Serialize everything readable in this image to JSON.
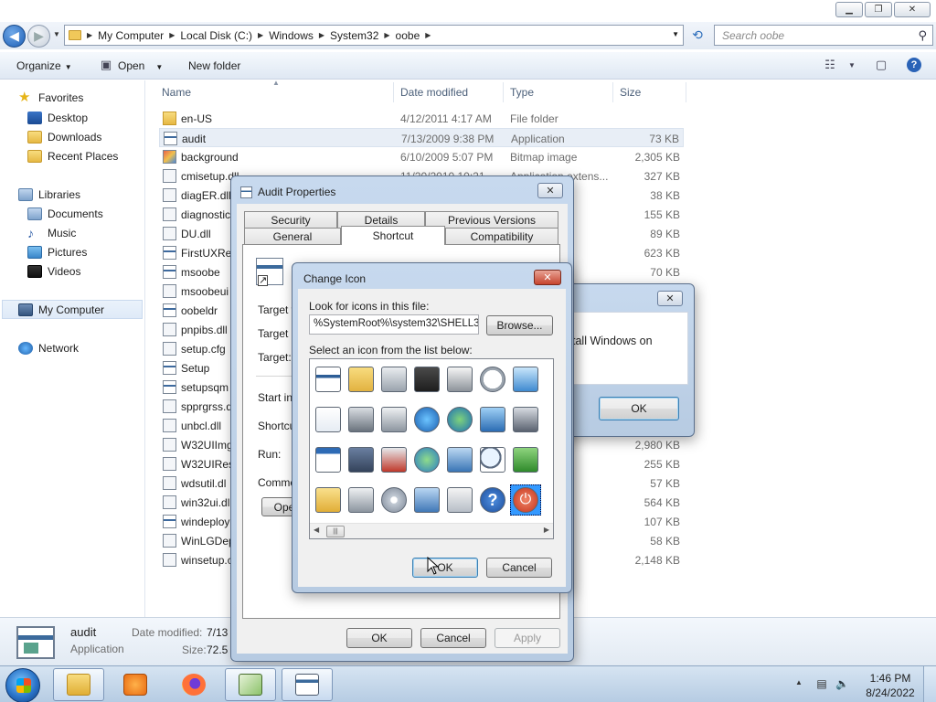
{
  "explorer": {
    "breadcrumb": [
      "My Computer",
      "Local Disk (C:)",
      "Windows",
      "System32",
      "oobe"
    ],
    "search_placeholder": "Search oobe",
    "toolbar": {
      "organize": "Organize",
      "open": "Open",
      "new_folder": "New folder"
    },
    "nav": {
      "favorites": "Favorites",
      "desktop": "Desktop",
      "downloads": "Downloads",
      "recent": "Recent Places",
      "libraries": "Libraries",
      "documents": "Documents",
      "music": "Music",
      "pictures": "Pictures",
      "videos": "Videos",
      "computer": "My Computer",
      "network": "Network"
    },
    "columns": {
      "name": "Name",
      "date": "Date modified",
      "type": "Type",
      "size": "Size"
    },
    "files": [
      {
        "name": "en-US",
        "date": "4/12/2011 4:17 AM",
        "type": "File folder",
        "size": "",
        "icon": "folder"
      },
      {
        "name": "audit",
        "date": "7/13/2009 9:38 PM",
        "type": "Application",
        "size": "73 KB",
        "icon": "app"
      },
      {
        "name": "background",
        "date": "6/10/2009 5:07 PM",
        "type": "Bitmap image",
        "size": "2,305 KB",
        "icon": "bmp"
      },
      {
        "name": "cmisetup.dll",
        "date": "11/20/2010 10:21...",
        "type": "Application extens...",
        "size": "327 KB",
        "icon": "dll"
      },
      {
        "name": "diagER.dll",
        "date": "",
        "type": "xtens...",
        "size": "38 KB",
        "icon": "dll"
      },
      {
        "name": "diagnostic",
        "date": "",
        "type": "xtens...",
        "size": "155 KB",
        "icon": "dll"
      },
      {
        "name": "DU.dll",
        "date": "",
        "type": "xtens...",
        "size": "89 KB",
        "icon": "dll"
      },
      {
        "name": "FirstUXRes",
        "date": "",
        "type": "",
        "size": "623 KB",
        "icon": "app"
      },
      {
        "name": "msoobe",
        "date": "",
        "type": "",
        "size": "70 KB",
        "icon": "app"
      },
      {
        "name": "msoobeui",
        "date": "",
        "type": "",
        "size": "",
        "icon": "dll"
      },
      {
        "name": "oobeldr",
        "date": "",
        "type": "",
        "size": "",
        "icon": "app"
      },
      {
        "name": "pnpibs.dll",
        "date": "",
        "type": "",
        "size": "",
        "icon": "dll"
      },
      {
        "name": "setup.cfg",
        "date": "",
        "type": "",
        "size": "",
        "icon": "cfg"
      },
      {
        "name": "Setup",
        "date": "",
        "type": "",
        "size": "",
        "icon": "setup"
      },
      {
        "name": "setupsqm",
        "date": "",
        "type": "",
        "size": "",
        "icon": "app"
      },
      {
        "name": "spprgrss.d",
        "date": "",
        "type": "",
        "size": "",
        "icon": "dll"
      },
      {
        "name": "unbcl.dll",
        "date": "",
        "type": "",
        "size": "",
        "icon": "dll"
      },
      {
        "name": "W32UIImg",
        "date": "",
        "type": "xtens...",
        "size": "2,980 KB",
        "icon": "dll"
      },
      {
        "name": "W32UIRes",
        "date": "",
        "type": "xtens...",
        "size": "255 KB",
        "icon": "dll"
      },
      {
        "name": "wdsutil.dl",
        "date": "",
        "type": "xtens...",
        "size": "57 KB",
        "icon": "dll"
      },
      {
        "name": "win32ui.dl",
        "date": "",
        "type": "xtens...",
        "size": "564 KB",
        "icon": "dll"
      },
      {
        "name": "windeploy",
        "date": "",
        "type": "",
        "size": "107 KB",
        "icon": "app"
      },
      {
        "name": "WinLGDep",
        "date": "",
        "type": "xtens...",
        "size": "58 KB",
        "icon": "dll"
      },
      {
        "name": "winsetup.c",
        "date": "",
        "type": "xtens...",
        "size": "2,148 KB",
        "icon": "dll"
      }
    ],
    "details": {
      "name": "audit",
      "type": "Application",
      "date_label": "Date modified:",
      "date_value": "7/13",
      "size_label": "Size:",
      "size_value": "72.5"
    }
  },
  "audit_dialog": {
    "title": "Audit Properties",
    "tabs_row1": [
      "Security",
      "Details",
      "Previous Versions"
    ],
    "tabs_row2": [
      "General",
      "Shortcut",
      "Compatibility"
    ],
    "active_tab": "Shortcut",
    "labels": {
      "target_type": "Target ty",
      "target_location": "Target lo",
      "target": "Target:",
      "start_in": "Start in:",
      "shortcut_key": "Shortcut",
      "run": "Run:",
      "comment": "Commen"
    },
    "open_btn": "Ope",
    "ok": "OK",
    "cancel": "Cancel",
    "apply": "Apply"
  },
  "msg_dialog": {
    "text": "tall Windows on",
    "ok": "OK"
  },
  "change_icon": {
    "title": "Change Icon",
    "look_label": "Look for icons in this file:",
    "path": "%SystemRoot%\\system32\\SHELL32.dll",
    "browse": "Browse...",
    "select_label": "Select an icon from the list below:",
    "ok": "OK",
    "cancel": "Cancel",
    "icons": [
      "application-window-icon",
      "folder-icon",
      "drive-icon",
      "chip-icon",
      "printer-icon",
      "clock-icon",
      "monitor-icon",
      "document-icon",
      "network-drive-icon",
      "disc-drive-icon",
      "globe-icon",
      "globe-network-icon",
      "control-panel-icon",
      "device-icon",
      "window-icon",
      "floppy-save-icon",
      "delete-drive-icon",
      "globe-computer-icon",
      "network-icon",
      "search-icon",
      "arrow-back-icon",
      "open-folder-icon",
      "removable-drive-icon",
      "cd-drive-icon",
      "computer-network-icon",
      "keyboard-icon",
      "help-icon",
      "power-icon"
    ]
  },
  "taskbar": {
    "time": "1:46 PM",
    "date": "8/24/2022"
  },
  "colors": {
    "selection_blue": "#3399ff",
    "power_red": "#d9432c",
    "help_blue": "#2a5fb0"
  }
}
